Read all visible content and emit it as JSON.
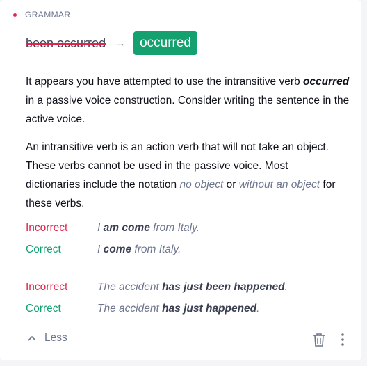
{
  "category": {
    "label": "GRAMMAR",
    "dot_color": "#e0244d"
  },
  "suggestion": {
    "original": "been occurred",
    "arrow": "→",
    "replacement": "occurred",
    "accent": "#15a16f"
  },
  "explanation": {
    "p1_before": "It appears you have attempted to use the intransitive verb ",
    "p1_emphasis": "occurred",
    "p1_after": " in a passive voice construction. Consider writing the sentence in the active voice.",
    "p2_before": "An intransitive verb is an action verb that will not take an object. These verbs cannot be used in the passive voice. Most dictionaries include the notation ",
    "p2_term1": "no object",
    "p2_mid": " or ",
    "p2_term2": "without an object",
    "p2_after": " for these verbs."
  },
  "examples": [
    {
      "label": "Incorrect",
      "pre": "I ",
      "bold": "am come",
      "post": " from Italy."
    },
    {
      "label": "Correct",
      "pre": "I ",
      "bold": "come",
      "post": " from Italy."
    },
    {
      "label": "Incorrect",
      "pre": "The accident ",
      "bold": "has just been happened",
      "post": "."
    },
    {
      "label": "Correct",
      "pre": "The accident ",
      "bold": "has just happened",
      "post": "."
    }
  ],
  "footer": {
    "less_label": "Less",
    "chevron_icon": "chevron-up-icon",
    "delete_icon": "trash-icon",
    "more_icon": "more-vertical-icon"
  }
}
